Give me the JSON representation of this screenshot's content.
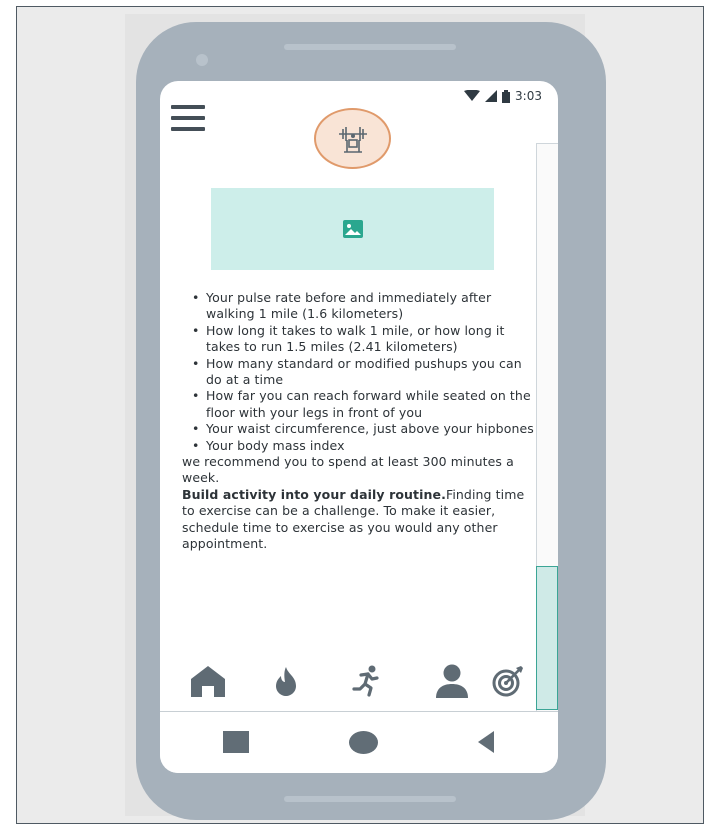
{
  "status_bar": {
    "time": "3:03"
  },
  "content": {
    "bullets": [
      "Your pulse rate before and immediately after walking 1 mile      (1.6 kilometers)",
      "How long it takes to walk 1 mile, or how long it takes to run     1.5 miles (2.41 kilometers)",
      "How many standard or modified pushups you can do at a time",
      "How far you can reach forward while seated on the floor with      your legs in front of you",
      "Your waist circumference, just above your hipbones",
      "Your body mass index"
    ],
    "recommendation": "we recommend you to spend at least 300 minutes a week.",
    "tip_heading": "Build activity into your daily routine.",
    "tip_body": "Finding time to exercise can be a challenge. To make it easier, schedule time to exercise as you would any other appointment."
  },
  "bottom_nav": {
    "items": [
      {
        "icon": "home-icon"
      },
      {
        "icon": "fire-icon"
      },
      {
        "icon": "running-icon"
      },
      {
        "icon": "person-icon"
      },
      {
        "icon": "target-icon"
      }
    ]
  },
  "colors": {
    "phone_body": "#a6b1bb",
    "icon_gray": "#5f6b74",
    "accent_teal": "#3ba596",
    "image_bg": "#cdeeea",
    "logo_fill": "#f9e4d6",
    "logo_border": "#e09a6b"
  }
}
